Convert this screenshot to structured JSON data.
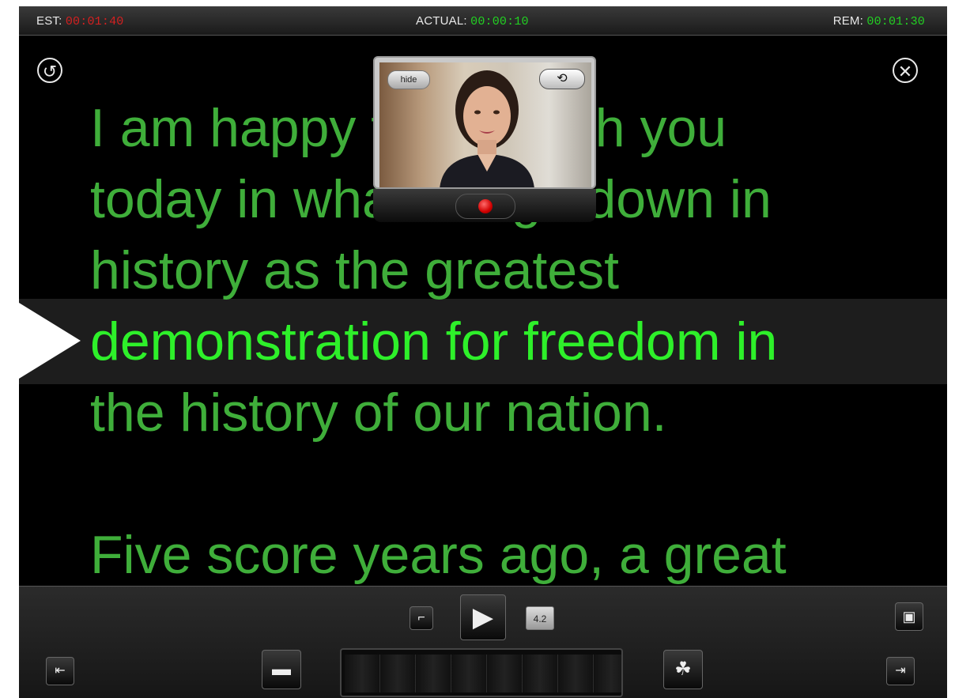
{
  "topbar": {
    "est_label": "EST:",
    "est_value": "00:01:40",
    "actual_label": "ACTUAL:",
    "actual_value": "00:00:10",
    "rem_label": "REM:",
    "rem_value": "00:01:30"
  },
  "colors": {
    "est_value": "#d42020",
    "actual_value": "#22d022",
    "rem_value": "#22d022",
    "script_text": "#3fae3a",
    "highlight_text": "#2ef02a"
  },
  "script": {
    "lines": [
      "I am happy to join with you",
      "today in what will go down in",
      "history as the greatest",
      "demonstration for freedom in",
      "the history of our nation.",
      "",
      "Five score years ago, a great"
    ],
    "highlighted_line_index": 3
  },
  "camera": {
    "hide_label": "hide",
    "flip_icon": "camera-flip-icon",
    "record_icon": "record-icon"
  },
  "controls": {
    "speed_value": "4.2",
    "lock_icon": "lock-icon",
    "play_icon": "play-icon",
    "camera_icon": "video-camera-icon",
    "start_icon": "jump-to-start-icon",
    "end_icon": "jump-to-end-icon",
    "slow_icon": "turtle-icon",
    "fast_icon": "rabbit-icon"
  }
}
